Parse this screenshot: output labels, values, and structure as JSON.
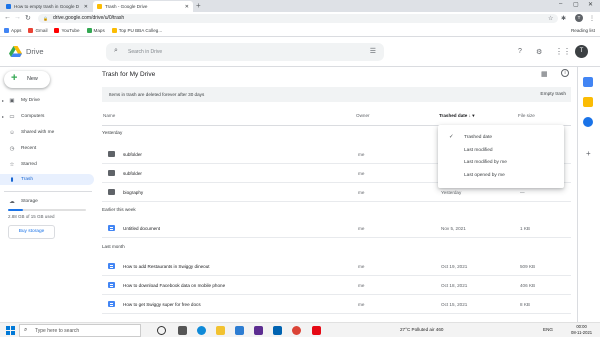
{
  "browser": {
    "tabs": [
      {
        "title": "How to empty trash in Google D",
        "favicon_color": "#1a73e8"
      },
      {
        "title": "Trash - Google Drive",
        "favicon_color": "#fbbc04"
      }
    ],
    "new_tab": "+",
    "url": "drive.google.com/drive/u/0/trash",
    "profile_initial": "T",
    "bookmarks": [
      {
        "label": "Apps",
        "color": "#4285f4"
      },
      {
        "label": "Gmail",
        "color": "#ea4335"
      },
      {
        "label": "YouTube",
        "color": "#ff0000"
      },
      {
        "label": "Maps",
        "color": "#34a853"
      },
      {
        "label": "Top PU BBA Colleg...",
        "color": "#fbbc04"
      }
    ],
    "reading_list": "Reading list"
  },
  "header": {
    "logo_text": "Drive",
    "search_placeholder": "Search in Drive",
    "avatar_initial": "T"
  },
  "sidebar": {
    "new_label": "New",
    "items": [
      {
        "label": "My Drive",
        "icon": "drive-icon",
        "icon_glyph": "▣",
        "caret": true
      },
      {
        "label": "Computers",
        "icon": "computer-icon",
        "icon_glyph": "▭",
        "caret": true
      },
      {
        "label": "Shared with me",
        "icon": "people-icon",
        "icon_glyph": "☺",
        "caret": false
      },
      {
        "label": "Recent",
        "icon": "clock-icon",
        "icon_glyph": "◷",
        "caret": false
      },
      {
        "label": "Starred",
        "icon": "star-icon",
        "icon_glyph": "☆",
        "caret": false
      },
      {
        "label": "Trash",
        "icon": "trash-icon",
        "icon_glyph": "▮",
        "caret": false,
        "active": true
      }
    ],
    "storage_label": "Storage",
    "storage_text": "2.88 GB of 15 GB used",
    "storage_used_fraction": 0.19,
    "buy_storage": "Buy storage"
  },
  "main": {
    "title": "Trash for My Drive",
    "banner_text": "Items in trash are deleted forever after 30 days",
    "empty_trash": "Empty trash",
    "columns": {
      "name": "Name",
      "owner": "Owner",
      "trashed_date": "Trashed date",
      "file_size": "File size"
    },
    "groups": [
      {
        "label": "Yesterday",
        "rows": [
          {
            "name": "subfolder",
            "owner": "me",
            "date": "",
            "size": "",
            "type": "folder"
          },
          {
            "name": "subfolder",
            "owner": "me",
            "date": "",
            "size": "",
            "type": "folder"
          },
          {
            "name": "biography",
            "owner": "me",
            "date": "Yesterday",
            "size": "—",
            "type": "folder"
          }
        ]
      },
      {
        "label": "Earlier this week",
        "rows": [
          {
            "name": "Untitled document",
            "owner": "me",
            "date": "Nov 5, 2021",
            "size": "1 KB",
            "type": "doc"
          }
        ]
      },
      {
        "label": "Last month",
        "rows": [
          {
            "name": "How to add Restaurants in Swiggy dineout",
            "owner": "me",
            "date": "Oct 19, 2021",
            "size": "509 KB",
            "type": "doc"
          },
          {
            "name": "How to download Facebook data on mobile phone",
            "owner": "me",
            "date": "Oct 18, 2021",
            "size": "406 KB",
            "type": "doc"
          },
          {
            "name": "How to get Swiggy super for free docs",
            "owner": "me",
            "date": "Oct 15, 2021",
            "size": "8 KB",
            "type": "doc"
          }
        ]
      }
    ],
    "sort_menu": [
      {
        "label": "Trashed date",
        "checked": true
      },
      {
        "label": "Last modified",
        "checked": false
      },
      {
        "label": "Last modified by me",
        "checked": false
      },
      {
        "label": "Last opened by me",
        "checked": false
      }
    ]
  },
  "taskbar": {
    "search_placeholder": "Type here to search",
    "weather": "27°C  Polluted air 460",
    "language": "ENG",
    "time": "00:00",
    "date": "08-11-2021"
  }
}
